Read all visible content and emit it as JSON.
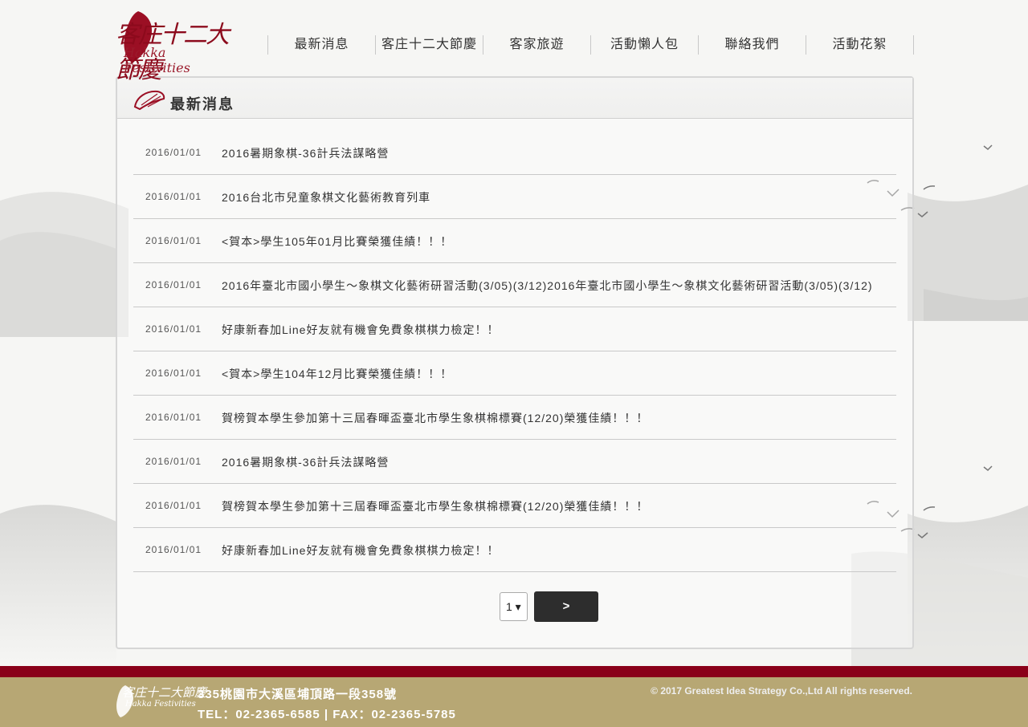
{
  "brand": {
    "logo_text": "客庄十二大節慶",
    "logo_sub": "Hakka Festivities"
  },
  "nav": {
    "items": [
      {
        "label": "最新消息"
      },
      {
        "label": "客庄十二大節慶"
      },
      {
        "label": "客家旅遊"
      },
      {
        "label": "活動懶人包"
      },
      {
        "label": "聯絡我們"
      },
      {
        "label": "活動花絮"
      }
    ]
  },
  "panel": {
    "title": "最新消息"
  },
  "news": [
    {
      "date": "2016/01/01",
      "title": "2016暑期象棋-36計兵法謀略營"
    },
    {
      "date": "2016/01/01",
      "title": "2016台北市兒童象棋文化藝術教育列車"
    },
    {
      "date": "2016/01/01",
      "title": "<賀本>學生105年01月比賽榮獲佳績！！！"
    },
    {
      "date": "2016/01/01",
      "title": "2016年臺北市國小學生～象棋文化藝術研習活動(3/05)(3/12)2016年臺北市國小學生～象棋文化藝術研習活動(3/05)(3/12)"
    },
    {
      "date": "2016/01/01",
      "title": "好康新春加Line好友就有機會免費象棋棋力檢定！！"
    },
    {
      "date": "2016/01/01",
      "title": "<賀本>學生104年12月比賽榮獲佳績！！！"
    },
    {
      "date": "2016/01/01",
      "title": "賀榜賀本學生參加第十三屆春暉盃臺北市學生象棋棉標賽(12/20)榮獲佳績！！！"
    },
    {
      "date": "2016/01/01",
      "title": "2016暑期象棋-36計兵法謀略營"
    },
    {
      "date": "2016/01/01",
      "title": "賀榜賀本學生參加第十三屆春暉盃臺北市學生象棋棉標賽(12/20)榮獲佳績！！！"
    },
    {
      "date": "2016/01/01",
      "title": "好康新春加Line好友就有機會免費象棋棋力檢定！！"
    }
  ],
  "pager": {
    "current_page": "1 ▾",
    "next_label": ">"
  },
  "footer": {
    "address": "335桃園市大溪區埔頂路一段358號",
    "contact": "TEL：02-2365-6585  |  FAX：02-2365-5785",
    "copyright": "© 2017 Greatest Idea Strategy Co.,Ltd All rights reserved.",
    "logo_text": "客庄十二大節慶",
    "logo_sub": "Hakka Festivities"
  },
  "colors": {
    "brand_red": "#8a0019",
    "footer_gold": "#b7a774",
    "button_dark": "#2d2d2d"
  }
}
